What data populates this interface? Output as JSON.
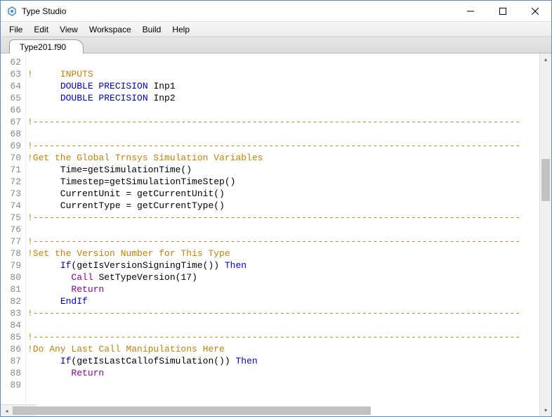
{
  "window": {
    "title": "Type Studio"
  },
  "menu": {
    "items": [
      "File",
      "Edit",
      "View",
      "Workspace",
      "Build",
      "Help"
    ]
  },
  "tabs": {
    "active": "Type201.f90"
  },
  "editor": {
    "first_line": 62,
    "lines": [
      {
        "n": 62,
        "tokens": []
      },
      {
        "n": 63,
        "tokens": [
          {
            "t": "!     INPUTS",
            "c": "comment"
          }
        ]
      },
      {
        "n": 64,
        "tokens": [
          {
            "t": "      ",
            "c": "plain"
          },
          {
            "t": "DOUBLE PRECISION",
            "c": "keyword"
          },
          {
            "t": " Inp1",
            "c": "plain"
          }
        ]
      },
      {
        "n": 65,
        "tokens": [
          {
            "t": "      ",
            "c": "plain"
          },
          {
            "t": "DOUBLE PRECISION",
            "c": "keyword"
          },
          {
            "t": " Inp2",
            "c": "plain"
          }
        ]
      },
      {
        "n": 66,
        "tokens": []
      },
      {
        "n": 67,
        "tokens": [
          {
            "t": "!-----------------------------------------------------------------------------------------",
            "c": "comment"
          }
        ]
      },
      {
        "n": 68,
        "tokens": []
      },
      {
        "n": 69,
        "tokens": [
          {
            "t": "!-----------------------------------------------------------------------------------------",
            "c": "comment"
          }
        ]
      },
      {
        "n": 70,
        "tokens": [
          {
            "t": "!Get the Global Trnsys Simulation Variables",
            "c": "comment"
          }
        ]
      },
      {
        "n": 71,
        "tokens": [
          {
            "t": "      Time=getSimulationTime()",
            "c": "plain"
          }
        ]
      },
      {
        "n": 72,
        "tokens": [
          {
            "t": "      Timestep=getSimulationTimeStep()",
            "c": "plain"
          }
        ]
      },
      {
        "n": 73,
        "tokens": [
          {
            "t": "      CurrentUnit = getCurrentUnit()",
            "c": "plain"
          }
        ]
      },
      {
        "n": 74,
        "tokens": [
          {
            "t": "      CurrentType = getCurrentType()",
            "c": "plain"
          }
        ]
      },
      {
        "n": 75,
        "tokens": [
          {
            "t": "!-----------------------------------------------------------------------------------------",
            "c": "comment"
          }
        ]
      },
      {
        "n": 76,
        "tokens": []
      },
      {
        "n": 77,
        "tokens": [
          {
            "t": "!-----------------------------------------------------------------------------------------",
            "c": "comment"
          }
        ]
      },
      {
        "n": 78,
        "tokens": [
          {
            "t": "!Set the Version Number for This Type",
            "c": "comment"
          }
        ]
      },
      {
        "n": 79,
        "tokens": [
          {
            "t": "      ",
            "c": "plain"
          },
          {
            "t": "If",
            "c": "keyword"
          },
          {
            "t": "(getIsVersionSigningTime()) ",
            "c": "plain"
          },
          {
            "t": "Then",
            "c": "keyword"
          }
        ]
      },
      {
        "n": 80,
        "tokens": [
          {
            "t": "        ",
            "c": "plain"
          },
          {
            "t": "Call",
            "c": "call"
          },
          {
            "t": " SetTypeVersion(17)",
            "c": "plain"
          }
        ]
      },
      {
        "n": 81,
        "tokens": [
          {
            "t": "        ",
            "c": "plain"
          },
          {
            "t": "Return",
            "c": "call"
          }
        ]
      },
      {
        "n": 82,
        "tokens": [
          {
            "t": "      ",
            "c": "plain"
          },
          {
            "t": "EndIf",
            "c": "keyword"
          }
        ]
      },
      {
        "n": 83,
        "tokens": [
          {
            "t": "!-----------------------------------------------------------------------------------------",
            "c": "comment"
          }
        ]
      },
      {
        "n": 84,
        "tokens": []
      },
      {
        "n": 85,
        "tokens": [
          {
            "t": "!-----------------------------------------------------------------------------------------",
            "c": "comment"
          }
        ]
      },
      {
        "n": 86,
        "tokens": [
          {
            "t": "!Do Any Last Call Manipulations Here",
            "c": "comment"
          }
        ]
      },
      {
        "n": 87,
        "tokens": [
          {
            "t": "      ",
            "c": "plain"
          },
          {
            "t": "If",
            "c": "keyword"
          },
          {
            "t": "(getIsLastCallofSimulation()) ",
            "c": "plain"
          },
          {
            "t": "Then",
            "c": "keyword"
          }
        ]
      },
      {
        "n": 88,
        "tokens": [
          {
            "t": "        ",
            "c": "plain"
          },
          {
            "t": "Return",
            "c": "call"
          }
        ]
      },
      {
        "n": 89,
        "tokens": []
      }
    ]
  }
}
